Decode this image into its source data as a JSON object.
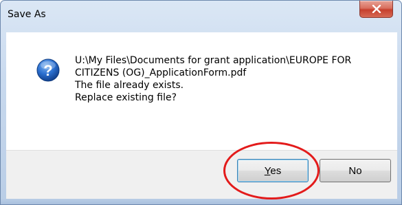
{
  "dialog": {
    "title": "Save As",
    "close_icon": "close-icon",
    "message_icon": "question-icon",
    "message_lines": [
      "U:\\My Files\\Documents for grant application\\EUROPE FOR",
      "CITIZENS (OG)_ApplicationForm.pdf",
      "The file already exists.",
      "Replace existing file?"
    ],
    "buttons": {
      "yes_mnemonic": "Y",
      "yes_rest": "es",
      "no_label": "No"
    }
  },
  "colors": {
    "highlight_ring": "#e31b1b",
    "close_button": "#c6402e",
    "question_icon": "#1f5fb5"
  }
}
